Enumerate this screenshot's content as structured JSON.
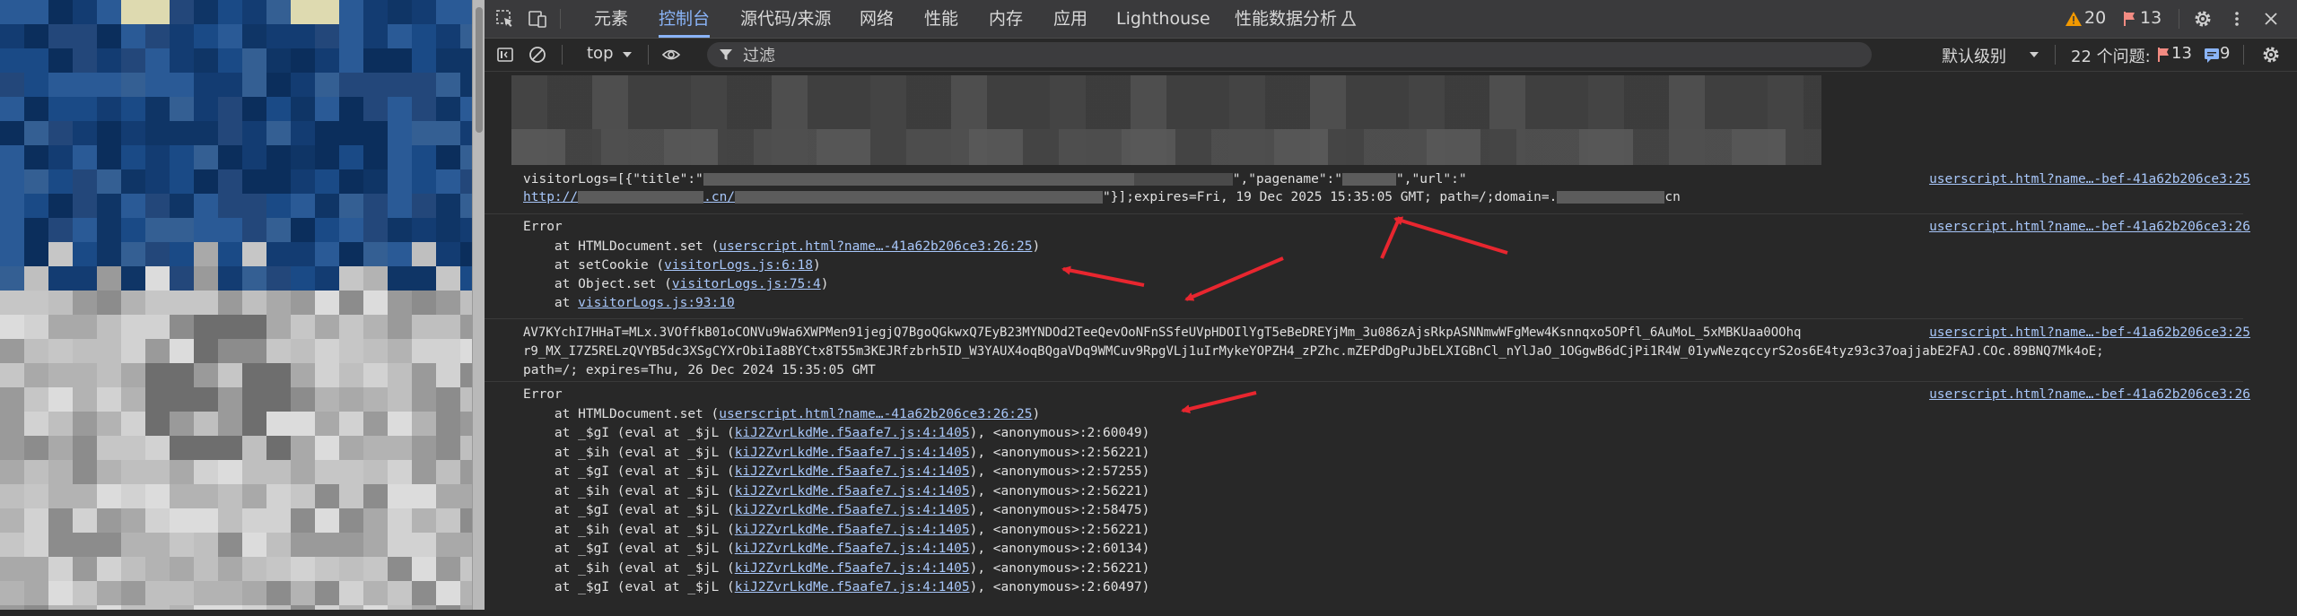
{
  "toolbar_tabs": [
    {
      "label": "元素",
      "active": false
    },
    {
      "label": "控制台",
      "active": true
    },
    {
      "label": "源代码/来源",
      "active": false
    },
    {
      "label": "网络",
      "active": false
    },
    {
      "label": "性能",
      "active": false
    },
    {
      "label": "内存",
      "active": false
    },
    {
      "label": "应用",
      "active": false
    },
    {
      "label": "Lighthouse",
      "active": false
    },
    {
      "label": "性能数据分析",
      "active": false
    }
  ],
  "status": {
    "warnings": "20",
    "errors": "13"
  },
  "console_toolbar": {
    "context": "top",
    "filter_placeholder": "过滤",
    "level": "默认级别",
    "issues_label": "22 个问题:",
    "issues_errors": "13",
    "issues_info": "9"
  },
  "entries": {
    "visitorlogs": {
      "part1": "visitorLogs=[{\"title\":\"",
      "part2": "\",\"pagename\":\"",
      "part3": "\",\"url\":\"",
      "url_prefix": "http://",
      "url_mid": ".cn/",
      "part4": "\"}];expires=Fri, 19 Dec 2025 15:35:05 GMT; path=/;domain=.",
      "part5": "cn",
      "source": "userscript.html?name…-bef-41a62b206ce3:25"
    },
    "error1": {
      "title": "Error",
      "frames": [
        {
          "pre": "    at HTMLDocument.set (",
          "link": "userscript.html?name…-41a62b206ce3:26:25",
          "post": ")"
        },
        {
          "pre": "    at setCookie (",
          "link": "visitorLogs.js:6:18",
          "post": ")"
        },
        {
          "pre": "    at Object.set (",
          "link": "visitorLogs.js:75:4",
          "post": ")"
        },
        {
          "pre": "    at ",
          "link": "visitorLogs.js:93:10",
          "post": ""
        }
      ],
      "source": "userscript.html?name…-bef-41a62b206ce3:26"
    },
    "cookie": {
      "lines": [
        "AV7KYchI7HHaT=MLx.3VOffkB01oCONVu9Wa6XWPMen91jegjQ7BgoQGkwxQ7EyB23MYNDOd2TeeQevOoNFnSSfeUVpHDOIlYgT5eBeDREYjMm_3u086zAjsRkpASNNmwWFgMew4Ksnnqxo5OPfl_6AuMoL_5xMBKUaa0OOhq",
        "r9_MX_I7Z5RELzQVYB5dc3XSgCYXrObiIa8BYCtx8T55m3KEJRfzbrh5ID_W3YAUX4oqBQgaVDq9WMCuv9RpgVLj1uIrMykeYOPZH4_zPZhc.mZEPdDgPuJbELXIGBnCl_nYlJaO_1OGgwB6dCjPi1R4W_01ywNezqccyrS2os6E4tyz93c37oajjabE2FAJ.COc.89BNQ7Mk4oE;",
        "path=/; expires=Thu, 26 Dec 2024 15:35:05 GMT"
      ],
      "source": "userscript.html?name…-bef-41a62b206ce3:25"
    },
    "error2": {
      "title": "Error",
      "first": {
        "pre": "    at HTMLDocument.set (",
        "link": "userscript.html?name…-41a62b206ce3:26:25",
        "post": ")"
      },
      "frames": [
        {
          "pre": "    at _$gI (eval at _$jL (",
          "link": "kiJ2ZvrLkdMe.f5aafe7.js:4:1405",
          "post": "), <anonymous>:2:60049)"
        },
        {
          "pre": "    at _$ih (eval at _$jL (",
          "link": "kiJ2ZvrLkdMe.f5aafe7.js:4:1405",
          "post": "), <anonymous>:2:56221)"
        },
        {
          "pre": "    at _$gI (eval at _$jL (",
          "link": "kiJ2ZvrLkdMe.f5aafe7.js:4:1405",
          "post": "), <anonymous>:2:57255)"
        },
        {
          "pre": "    at _$ih (eval at _$jL (",
          "link": "kiJ2ZvrLkdMe.f5aafe7.js:4:1405",
          "post": "), <anonymous>:2:56221)"
        },
        {
          "pre": "    at _$gI (eval at _$jL (",
          "link": "kiJ2ZvrLkdMe.f5aafe7.js:4:1405",
          "post": "), <anonymous>:2:58475)"
        },
        {
          "pre": "    at _$ih (eval at _$jL (",
          "link": "kiJ2ZvrLkdMe.f5aafe7.js:4:1405",
          "post": "), <anonymous>:2:56221)"
        },
        {
          "pre": "    at _$gI (eval at _$jL (",
          "link": "kiJ2ZvrLkdMe.f5aafe7.js:4:1405",
          "post": "), <anonymous>:2:60134)"
        },
        {
          "pre": "    at _$ih (eval at _$jL (",
          "link": "kiJ2ZvrLkdMe.f5aafe7.js:4:1405",
          "post": "), <anonymous>:2:56221)"
        },
        {
          "pre": "    at _$gI (eval at _$jL (",
          "link": "kiJ2ZvrLkdMe.f5aafe7.js:4:1405",
          "post": "), <anonymous>:2:60497)"
        }
      ],
      "source": "userscript.html?name…-bef-41a62b206ce3:26"
    }
  },
  "colors": {
    "accent": "#8ab4f8",
    "link": "#a8c7fa",
    "arrow": "#e8262f",
    "warning": "#f29900",
    "error": "#f28b82"
  }
}
